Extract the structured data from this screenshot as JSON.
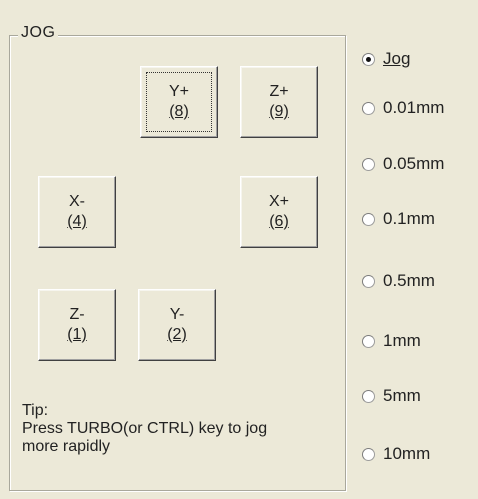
{
  "group_title": "JOG",
  "buttons": {
    "y_plus": {
      "label": "Y+",
      "key": "(8)"
    },
    "z_plus": {
      "label": "Z+",
      "key": "(9)"
    },
    "x_minus": {
      "label": "X-",
      "key": "(4)"
    },
    "x_plus": {
      "label": "X+",
      "key": "(6)"
    },
    "z_minus": {
      "label": "Z-",
      "key": "(1)"
    },
    "y_minus": {
      "label": "Y-",
      "key": "(2)"
    }
  },
  "tip": {
    "line1": "Tip:",
    "line2": "Press TURBO(or CTRL) key to jog",
    "line3": "more rapidly"
  },
  "step_options": {
    "selected": "Jog",
    "items": [
      "Jog",
      "0.01mm",
      "0.05mm",
      "0.1mm",
      "0.5mm",
      "1mm",
      "5mm",
      "10mm"
    ]
  }
}
